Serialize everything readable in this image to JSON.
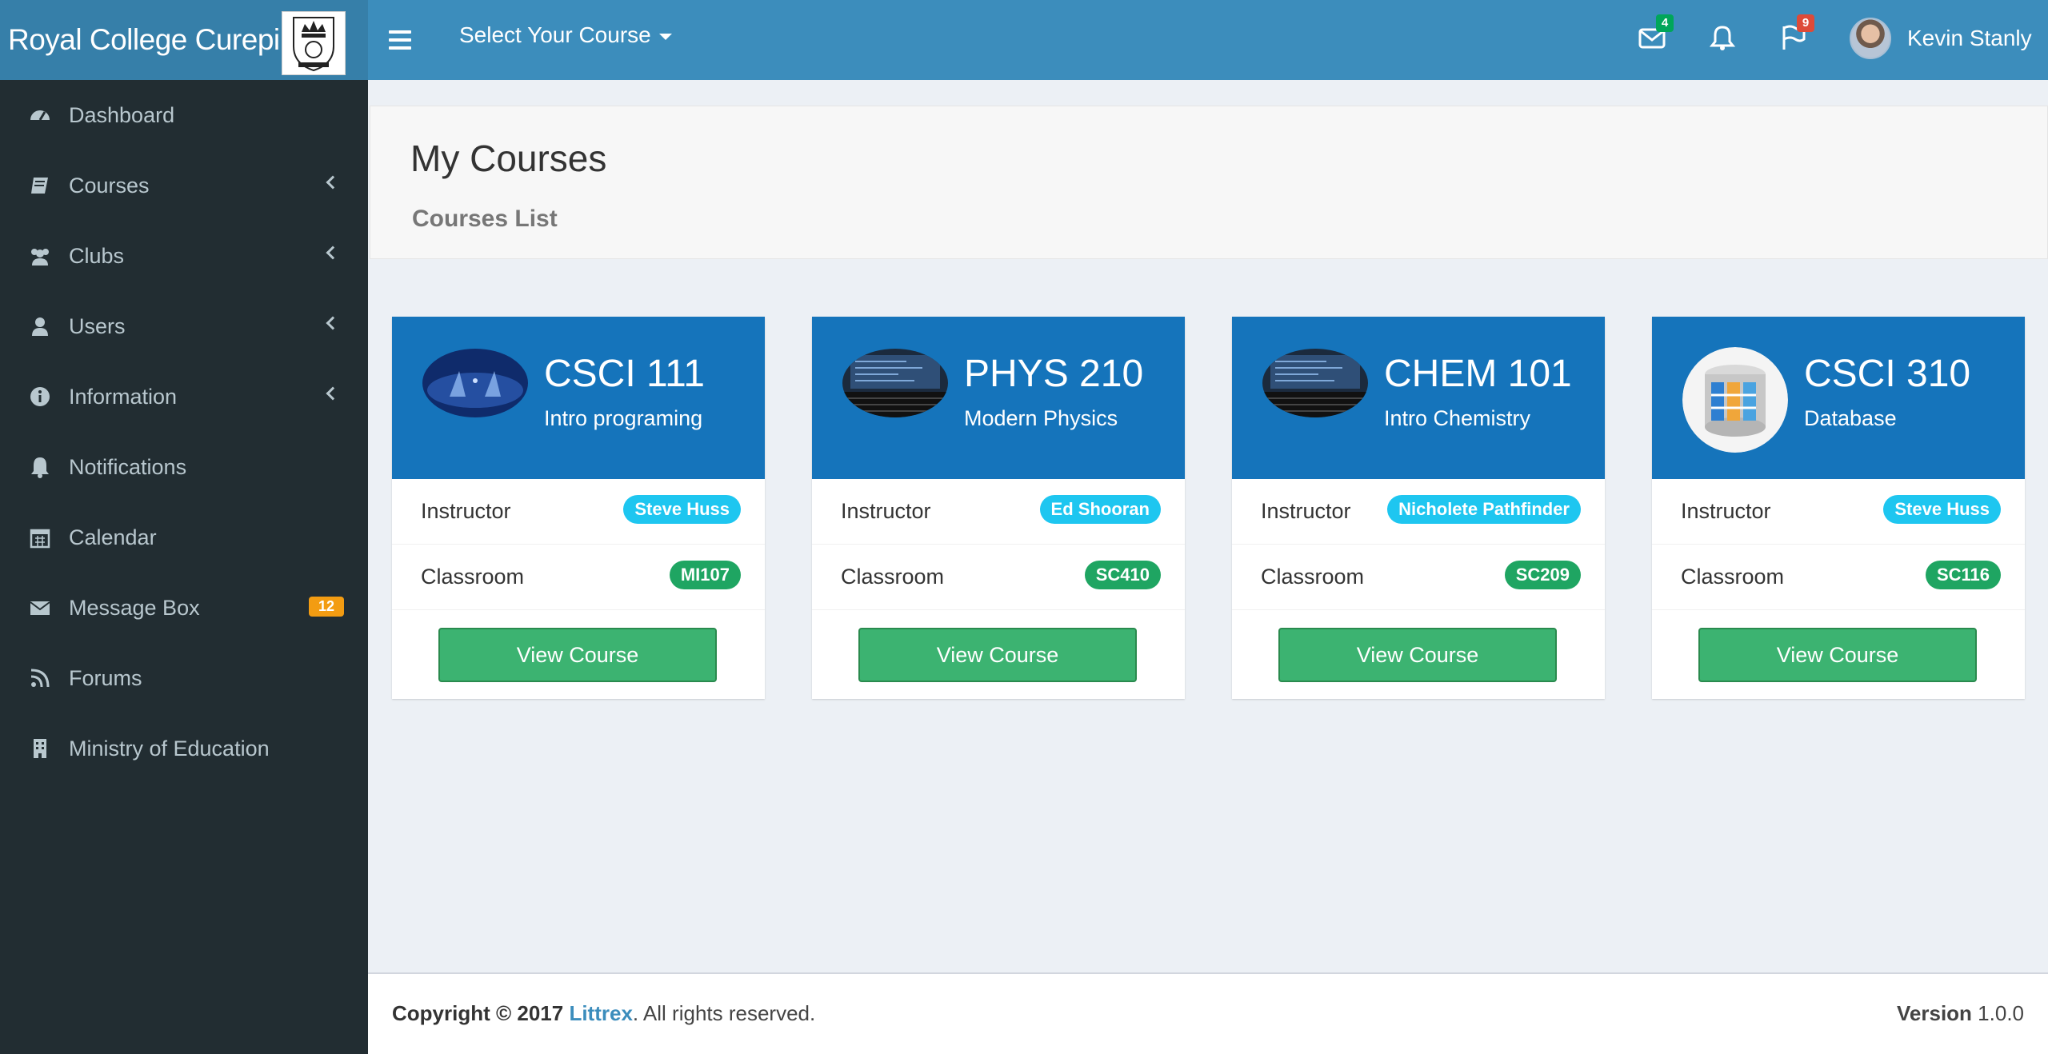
{
  "header": {
    "brand_name": "Royal College Curepipe",
    "course_selector": "Select Your Course",
    "messages_badge": "4",
    "flags_badge": "9",
    "user_name": "Kevin Stanly"
  },
  "sidebar": {
    "items": [
      {
        "label": "Dashboard",
        "icon": "dashboard-icon"
      },
      {
        "label": "Courses",
        "icon": "book-icon"
      },
      {
        "label": "Clubs",
        "icon": "users-group-icon"
      },
      {
        "label": "Users",
        "icon": "user-icon"
      },
      {
        "label": "Information",
        "icon": "info-icon"
      },
      {
        "label": "Notifications",
        "icon": "bell-icon"
      },
      {
        "label": "Calendar",
        "icon": "calendar-icon"
      },
      {
        "label": "Message Box",
        "icon": "envelope-icon",
        "badge": "12"
      },
      {
        "label": "Forums",
        "icon": "feed-icon"
      },
      {
        "label": "Ministry of Education",
        "icon": "building-icon"
      }
    ]
  },
  "content": {
    "title": "My Courses",
    "subtitle": "Courses List"
  },
  "labels": {
    "instructor": "Instructor",
    "classroom": "Classroom",
    "view_course": "View Course"
  },
  "courses": [
    {
      "code": "CSCI 111",
      "name": "Intro programing",
      "instructor": "Steve Huss",
      "classroom": "MI107"
    },
    {
      "code": "PHYS 210",
      "name": "Modern Physics",
      "instructor": "Ed Shooran",
      "classroom": "SC410"
    },
    {
      "code": "CHEM 101",
      "name": "Intro Chemistry",
      "instructor": "Nicholete Pathfinder",
      "classroom": "SC209"
    },
    {
      "code": "CSCI 310",
      "name": "Database",
      "instructor": "Steve Huss",
      "classroom": "SC116"
    }
  ],
  "footer": {
    "copyright_prefix": "Copyright © 2017",
    "company": "Littrex",
    "rights": ". All rights reserved.",
    "version_label": "Version",
    "version_value": "1.0.0"
  },
  "colors": {
    "header": "#3c8dbc",
    "sidebar": "#222d32",
    "card_header": "#1574bb",
    "button": "#3cb371"
  }
}
